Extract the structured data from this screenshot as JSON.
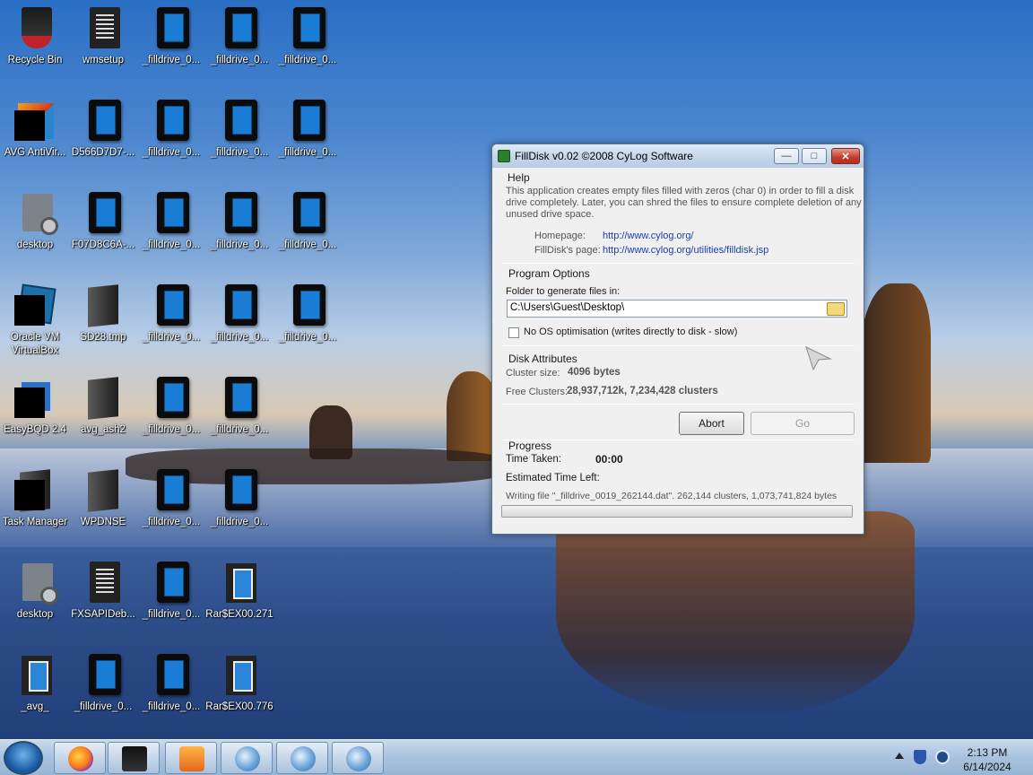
{
  "desktop": {
    "icons": [
      {
        "label": "Recycle Bin",
        "icon": "recycle-bin-icon"
      },
      {
        "label": "wmsetup",
        "icon": "document-icon"
      },
      {
        "label": "_filldrive_0...",
        "icon": "file-icon"
      },
      {
        "label": "_filldrive_0...",
        "icon": "file-icon"
      },
      {
        "label": "_filldrive_0...",
        "icon": "file-icon"
      },
      {
        "label": "AVG AntiVir...",
        "icon": "avg-antivirus-icon"
      },
      {
        "label": "D566D7D7-...",
        "icon": "file-icon"
      },
      {
        "label": "_filldrive_0...",
        "icon": "file-icon"
      },
      {
        "label": "_filldrive_0...",
        "icon": "file-icon"
      },
      {
        "label": "_filldrive_0...",
        "icon": "file-icon"
      },
      {
        "label": "desktop",
        "icon": "settings-file-icon"
      },
      {
        "label": "F07D8C6A-...",
        "icon": "file-icon"
      },
      {
        "label": "_filldrive_0...",
        "icon": "file-icon"
      },
      {
        "label": "_filldrive_0...",
        "icon": "file-icon"
      },
      {
        "label": "_filldrive_0...",
        "icon": "file-icon"
      },
      {
        "label": "Oracle VM VirtualBox",
        "icon": "virtualbox-icon"
      },
      {
        "label": "SD28.tmp",
        "icon": "tmp-file-icon"
      },
      {
        "label": "_filldrive_0...",
        "icon": "file-icon"
      },
      {
        "label": "_filldrive_0...",
        "icon": "file-icon"
      },
      {
        "label": "_filldrive_0...",
        "icon": "file-icon"
      },
      {
        "label": "EasyBQD 2.4",
        "icon": "easybcd-icon"
      },
      {
        "label": "avg_ash2",
        "icon": "folder-dark-icon"
      },
      {
        "label": "_filldrive_0...",
        "icon": "file-icon"
      },
      {
        "label": "_filldrive_0...",
        "icon": "file-icon"
      },
      {
        "label": "Task Manager",
        "icon": "task-manager-icon"
      },
      {
        "label": "WPDNSE",
        "icon": "folder-dark-icon"
      },
      {
        "label": "_filldrive_0...",
        "icon": "file-icon"
      },
      {
        "label": "_filldrive_0...",
        "icon": "file-icon"
      },
      {
        "label": "desktop",
        "icon": "settings-file-icon"
      },
      {
        "label": "FXSAPIDeb...",
        "icon": "document-icon"
      },
      {
        "label": "_filldrive_0...",
        "icon": "file-icon"
      },
      {
        "label": "Rar$EX00.271",
        "icon": "rar-folder-icon"
      },
      {
        "label": "_avg_",
        "icon": "rar-folder-icon"
      },
      {
        "label": "_filldrive_0...",
        "icon": "file-icon"
      },
      {
        "label": "_filldrive_0...",
        "icon": "file-icon"
      },
      {
        "label": "Rar$EX00.776",
        "icon": "rar-folder-icon"
      }
    ]
  },
  "window": {
    "title": "FillDisk v0.02 ©2008 CyLog Software",
    "minimize_label": "—",
    "maximize_label": "□",
    "close_label": "✕",
    "help": {
      "heading": "Help",
      "description_line1": "This application creates empty files filled with zeros (char 0) in order to fill a disk",
      "description_line2": "drive completely. Later, you can shred the files to ensure complete deletion of any",
      "description_line3": "unused drive space.",
      "homepage_label": "Homepage:",
      "homepage_url": "http://www.cylog.org/",
      "page_label": "FillDisk's page:",
      "page_url": "http://www.cylog.org/utilities/filldisk.jsp"
    },
    "program_options": {
      "heading": "Program Options",
      "folder_label": "Folder to generate files in:",
      "folder_value": "C:\\Users\\Guest\\Desktop\\",
      "no_os_label": "No OS optimisation (writes directly to disk - slow)",
      "no_os_checked": false
    },
    "disk_attributes": {
      "heading": "Disk Attributes",
      "cluster_size_label": "Cluster size:",
      "cluster_size_value": "4096 bytes",
      "free_clusters_label": "Free Clusters:",
      "free_clusters_value": "28,937,712k, 7,234,428 clusters"
    },
    "buttons": {
      "abort": "Abort",
      "go": "Go"
    },
    "progress": {
      "heading": "Progress",
      "time_taken_label": "Time Taken:",
      "time_taken_value": "00:00",
      "estimated_label": "Estimated Time Left:",
      "status_text": "Writing file \"_filldrive_0019_262144.dat\". 262,144 clusters, 1,073,741,824 bytes",
      "fraction": 0
    }
  },
  "taskbar": {
    "items": [
      {
        "name": "firefox-taskbar-item",
        "icon": "firefox-icon"
      },
      {
        "name": "terminal-taskbar-item",
        "icon": "terminal-icon"
      },
      {
        "name": "media-player-taskbar-item",
        "icon": "media-player-icon"
      },
      {
        "name": "filldisk-taskbar-item-1",
        "icon": "globe-icon"
      },
      {
        "name": "filldisk-taskbar-item-2",
        "icon": "globe-icon"
      },
      {
        "name": "filldisk-taskbar-item-3",
        "icon": "globe-icon"
      }
    ],
    "clock_time": "2:13 PM",
    "clock_date": "6/14/2024"
  }
}
